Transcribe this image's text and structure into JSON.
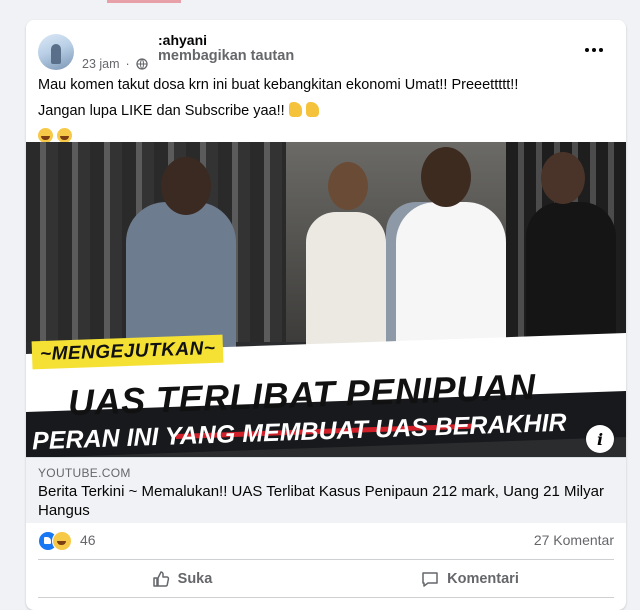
{
  "post": {
    "author_name": ":ahyani",
    "author_action": "membagikan tautan",
    "time": "23 jam",
    "text_line1": "Mau komen takut dosa krn ini buat kebangkitan ekonomi Umat!! Preeettttt!!",
    "text_line2": "Jangan lupa LIKE dan Subscribe yaa!!"
  },
  "media": {
    "tag": "~MENGEJUTKAN~",
    "headline": "UAS TERLIBAT PENIPUAN",
    "subline": "PERAN INI YANG MEMBUAT UAS BERAKHIR",
    "info": "i"
  },
  "link": {
    "domain": "YOUTUBE.COM",
    "title": "Berita Terkini ~ Memalukan!! UAS Terlibat Kasus Penipaun 212 mark, Uang 21 Milyar Hangus"
  },
  "stats": {
    "reactions": "46",
    "comments": "27 Komentar"
  },
  "actions": {
    "like": "Suka",
    "comment": "Komentari"
  },
  "colors": {
    "accent": "#1877f2",
    "banner_yellow": "#f5e133",
    "banner_dark": "#17191c",
    "banner_red": "#d0202a"
  }
}
